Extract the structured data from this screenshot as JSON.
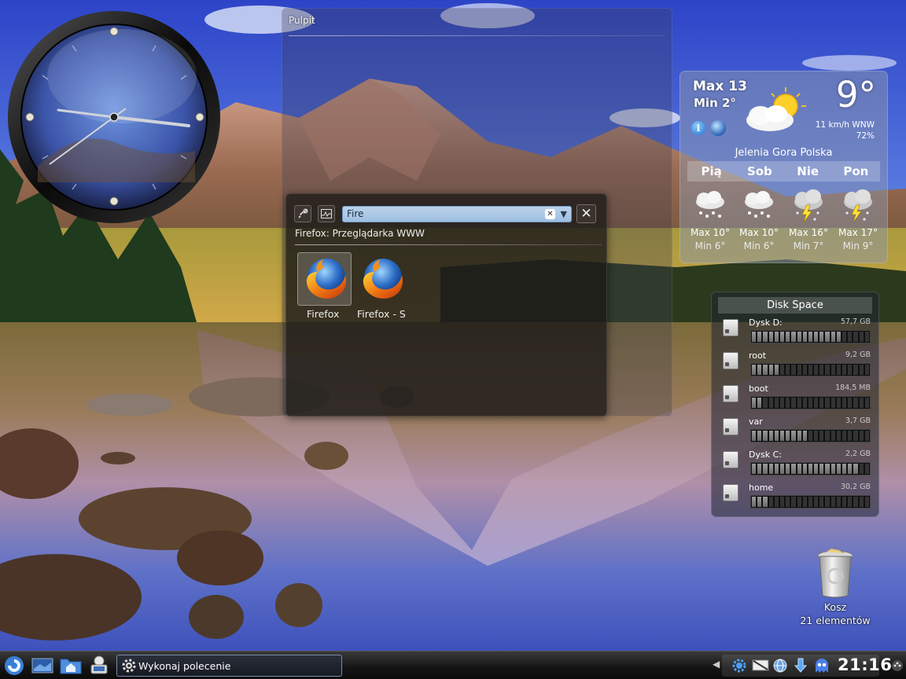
{
  "folder_view": {
    "title": "Pulpit"
  },
  "krunner": {
    "search_value": "Fire",
    "description": "Firefox: Przeglądarka WWW",
    "results": [
      {
        "label": "Firefox",
        "icon": "firefox-icon"
      },
      {
        "label": "Firefox - S",
        "icon": "firefox-icon"
      }
    ]
  },
  "weather": {
    "max_today": "Max 13",
    "min_today": "Min 2°",
    "temperature": "9°",
    "wind": "11 km/h WNW",
    "humidity": "72%",
    "location": "Jelenia Gora Polska",
    "days": [
      {
        "name": "Pią",
        "max": "Max 10°",
        "min": "Min 6°",
        "icon": "snow-cloud-icon"
      },
      {
        "name": "Sob",
        "max": "Max 10°",
        "min": "Min 6°",
        "icon": "snow-cloud-icon"
      },
      {
        "name": "Nie",
        "max": "Max 16°",
        "min": "Min 7°",
        "icon": "thunderstorm-icon"
      },
      {
        "name": "Pon",
        "max": "Max 17°",
        "min": "Min 9°",
        "icon": "thunderstorm-icon"
      }
    ]
  },
  "disk_space": {
    "title": "Disk Space",
    "disks": [
      {
        "name": "Dysk D:",
        "size": "57,7 GB",
        "usage": 0.76
      },
      {
        "name": "root",
        "size": "9,2 GB",
        "usage": 0.24
      },
      {
        "name": "boot",
        "size": "184,5 MB",
        "usage": 0.08
      },
      {
        "name": "var",
        "size": "3,7 GB",
        "usage": 0.48
      },
      {
        "name": "Dysk C:",
        "size": "2,2 GB",
        "usage": 0.9
      },
      {
        "name": "home",
        "size": "30,2 GB",
        "usage": 0.12
      }
    ]
  },
  "trash": {
    "name": "Kosz",
    "count": "21 elementów"
  },
  "taskbar": {
    "task_label": "Wykonaj polecenie",
    "time": "21:16"
  },
  "colors": {
    "accent": "#9ec0e2",
    "panel": "#141414"
  }
}
